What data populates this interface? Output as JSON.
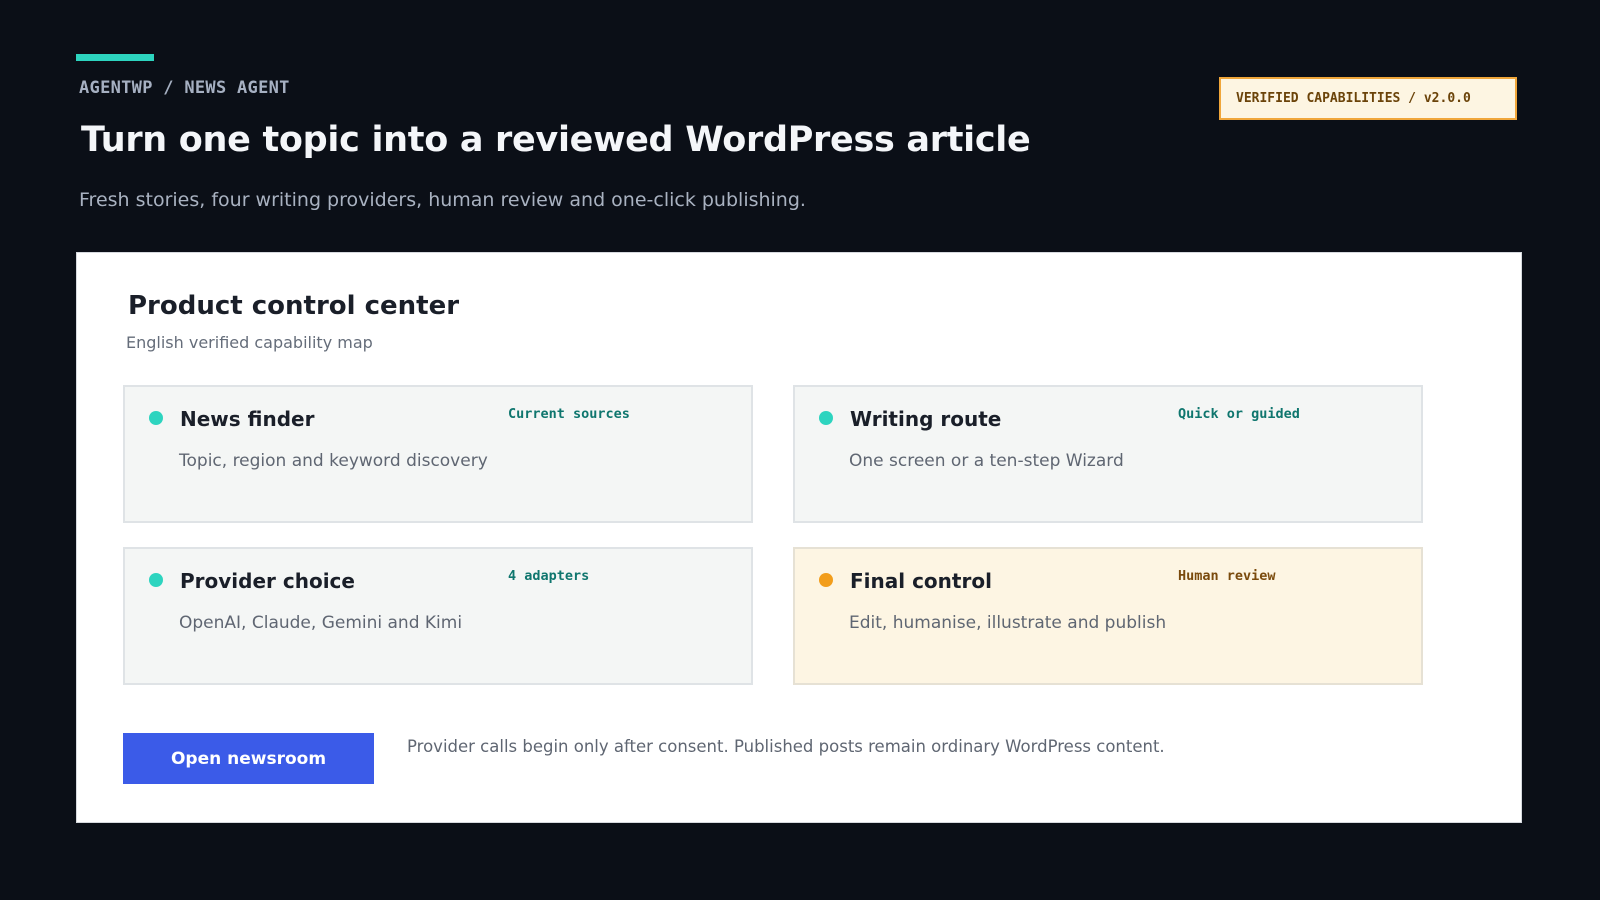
{
  "header": {
    "breadcrumb": "AGENTWP / NEWS AGENT",
    "title": "Turn one topic into a reviewed WordPress article",
    "subtitle": "Fresh stories, four writing providers, human review and one-click publishing.",
    "badge": "VERIFIED CAPABILITIES / v2.0.0"
  },
  "panel": {
    "title": "Product control center",
    "subtitle": "English verified capability map",
    "cards": [
      {
        "title": "News finder",
        "tag": "Current sources",
        "description": "Topic, region and keyword discovery",
        "status_color": "#2dd4bf"
      },
      {
        "title": "Writing route",
        "tag": "Quick or guided",
        "description": "One screen or a ten-step Wizard",
        "status_color": "#2dd4bf"
      },
      {
        "title": "Provider choice",
        "tag": "4 adapters",
        "description": "OpenAI, Claude, Gemini and Kimi",
        "status_color": "#2dd4bf"
      },
      {
        "title": "Final control",
        "tag": "Human review",
        "description": "Edit, humanise, illustrate and publish",
        "status_color": "#f29d1b"
      }
    ],
    "cta_label": "Open newsroom",
    "footnote": "Provider calls begin only after consent. Published posts remain ordinary WordPress content."
  },
  "colors": {
    "background": "#0b0f17",
    "accent": "#2dd4bf",
    "primary_button": "#3b5be8",
    "warning": "#f29d1b"
  }
}
